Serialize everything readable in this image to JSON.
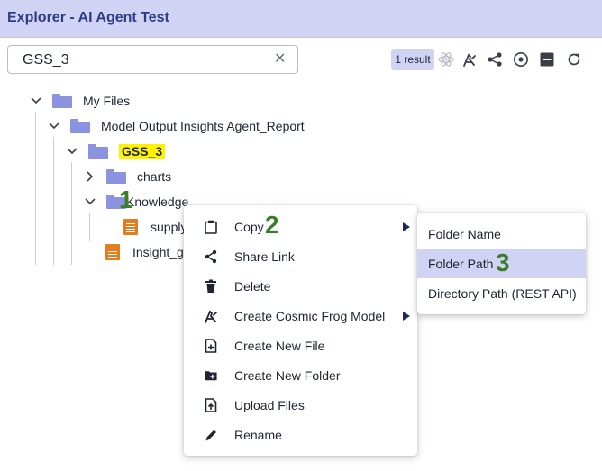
{
  "window": {
    "title": "Explorer - AI Agent Test"
  },
  "search": {
    "value": "GSS_3",
    "clear_symbol": "✕"
  },
  "toolbar": {
    "result_count": "1 result",
    "icons": [
      "atom-icon",
      "frog-icon",
      "share-icon",
      "target-icon",
      "collapse-icon",
      "refresh-icon"
    ]
  },
  "tree": {
    "items": [
      {
        "label": "My Files",
        "type": "folder",
        "expanded": true
      },
      {
        "label": "Model Output Insights Agent_Report",
        "type": "folder",
        "expanded": true
      },
      {
        "label": "GSS_3",
        "type": "folder",
        "expanded": true,
        "highlighted": true
      },
      {
        "label": "charts",
        "type": "folder",
        "expanded": false
      },
      {
        "label": "Knowledge",
        "type": "folder",
        "expanded": true
      },
      {
        "label": "supply",
        "type": "file"
      },
      {
        "label": "Insight_g",
        "type": "file"
      }
    ]
  },
  "context_menu": {
    "items": [
      {
        "label": "Copy",
        "icon": "clipboard-icon",
        "has_submenu": true
      },
      {
        "label": "Share Link",
        "icon": "share-icon",
        "has_submenu": false
      },
      {
        "label": "Delete",
        "icon": "trash-icon",
        "has_submenu": false
      },
      {
        "label": "Create Cosmic Frog Model",
        "icon": "frog-icon",
        "has_submenu": true
      },
      {
        "label": "Create New File",
        "icon": "new-file-icon",
        "has_submenu": false
      },
      {
        "label": "Create New Folder",
        "icon": "new-folder-icon",
        "has_submenu": false
      },
      {
        "label": "Upload Files",
        "icon": "upload-icon",
        "has_submenu": false
      },
      {
        "label": "Rename",
        "icon": "pencil-icon",
        "has_submenu": false
      }
    ]
  },
  "submenu": {
    "items": [
      {
        "label": "Folder Name",
        "active": false
      },
      {
        "label": "Folder Path",
        "active": true
      },
      {
        "label": "Directory Path (REST API)",
        "active": false
      }
    ]
  },
  "step_markers": [
    "1",
    "2",
    "3"
  ],
  "colors": {
    "title_bar": "#d1d3f4",
    "title_text": "#2d3e86",
    "folder": "#8b92e0",
    "file": "#e37d1d",
    "highlight": "#fff200",
    "step_marker": "#3a7d2b",
    "submenu_active": "#d1d3f4"
  }
}
